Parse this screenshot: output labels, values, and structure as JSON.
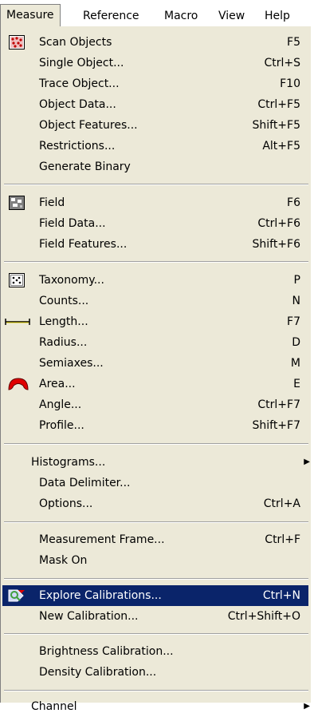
{
  "menubar": {
    "items": [
      {
        "label": "Measure",
        "active": true
      },
      {
        "label": "Reference"
      },
      {
        "label": "Macro"
      },
      {
        "label": "View"
      },
      {
        "label": "Help"
      }
    ]
  },
  "menu": {
    "items": [
      {
        "label": "Scan Objects",
        "shortcut": "F5",
        "icon": "scan-objects-icon"
      },
      {
        "label": "Single Object...",
        "shortcut": "Ctrl+S"
      },
      {
        "label": "Trace Object...",
        "shortcut": "F10"
      },
      {
        "label": "Object Data...",
        "shortcut": "Ctrl+F5"
      },
      {
        "label": "Object Features...",
        "shortcut": "Shift+F5"
      },
      {
        "label": "Restrictions...",
        "shortcut": "Alt+F5"
      },
      {
        "label": "Generate Binary",
        "shortcut": ""
      },
      {
        "label": "Field",
        "shortcut": "F6",
        "icon": "field-icon"
      },
      {
        "label": "Field Data...",
        "shortcut": "Ctrl+F6"
      },
      {
        "label": "Field Features...",
        "shortcut": "Shift+F6"
      },
      {
        "label": "Taxonomy...",
        "shortcut": "P",
        "icon": "taxonomy-icon"
      },
      {
        "label": "Counts...",
        "shortcut": "N"
      },
      {
        "label": "Length...",
        "shortcut": "F7",
        "icon": "length-icon"
      },
      {
        "label": "Radius...",
        "shortcut": "D"
      },
      {
        "label": "Semiaxes...",
        "shortcut": "M"
      },
      {
        "label": "Area...",
        "shortcut": "E",
        "icon": "area-icon"
      },
      {
        "label": "Angle...",
        "shortcut": "Ctrl+F7"
      },
      {
        "label": "Profile...",
        "shortcut": "Shift+F7"
      },
      {
        "label": "Histograms...",
        "shortcut": "",
        "submenu": true
      },
      {
        "label": "Data Delimiter...",
        "shortcut": ""
      },
      {
        "label": "Options...",
        "shortcut": "Ctrl+A"
      },
      {
        "label": "Measurement Frame...",
        "shortcut": "Ctrl+F"
      },
      {
        "label": "Mask On",
        "shortcut": ""
      },
      {
        "label": "Explore Calibrations...",
        "shortcut": "Ctrl+N",
        "icon": "explore-calibrations-icon",
        "highlighted": true
      },
      {
        "label": "New Calibration...",
        "shortcut": "Ctrl+Shift+O"
      },
      {
        "label": "Brightness Calibration...",
        "shortcut": ""
      },
      {
        "label": "Density Calibration...",
        "shortcut": ""
      },
      {
        "label": "Channel",
        "shortcut": "",
        "submenu": true
      }
    ]
  },
  "colors": {
    "menu_background": "#ece9d8",
    "highlight": "#0a246a",
    "highlight_text": "#ffffff"
  }
}
